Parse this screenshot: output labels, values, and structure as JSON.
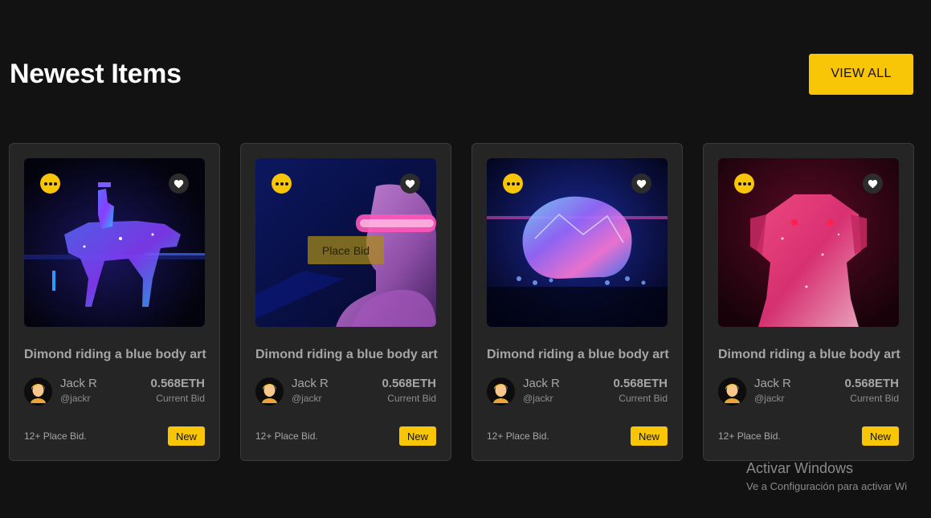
{
  "section": {
    "title": "Newest Items",
    "view_all_label": "VIEW ALL"
  },
  "colors": {
    "accent": "#f9c507",
    "background": "#121212",
    "card": "#252525"
  },
  "cards": [
    {
      "art": "crystal-rider-on-bull",
      "title": "Dimond riding a blue body art",
      "owner_name": "Jack R",
      "owner_handle": "@jackr",
      "bid_value": "0.568ETH",
      "bid_label": "Current Bid",
      "bids_count": "12+ Place Bid.",
      "badge": "New",
      "overlay_label": ""
    },
    {
      "art": "woman-with-vr-visor",
      "title": "Dimond riding a blue body art",
      "owner_name": "Jack R",
      "owner_handle": "@jackr",
      "bid_value": "0.568ETH",
      "bid_label": "Current Bid",
      "bids_count": "12+ Place Bid.",
      "badge": "New",
      "overlay_label": "Place Bid"
    },
    {
      "art": "crystal-brain",
      "title": "Dimond riding a blue body art",
      "owner_name": "Jack R",
      "owner_handle": "@jackr",
      "bid_value": "0.568ETH",
      "bid_label": "Current Bid",
      "bids_count": "12+ Place Bid.",
      "badge": "New",
      "overlay_label": ""
    },
    {
      "art": "crystal-dog",
      "title": "Dimond riding a blue body art",
      "owner_name": "Jack R",
      "owner_handle": "@jackr",
      "bid_value": "0.568ETH",
      "bid_label": "Current Bid",
      "bids_count": "12+ Place Bid.",
      "badge": "New",
      "overlay_label": ""
    }
  ],
  "icons": {
    "more": "more-dots-icon",
    "like": "heart-icon"
  },
  "watermark": {
    "title": "Activar Windows",
    "subtitle": "Ve a Configuración para activar Wi"
  }
}
